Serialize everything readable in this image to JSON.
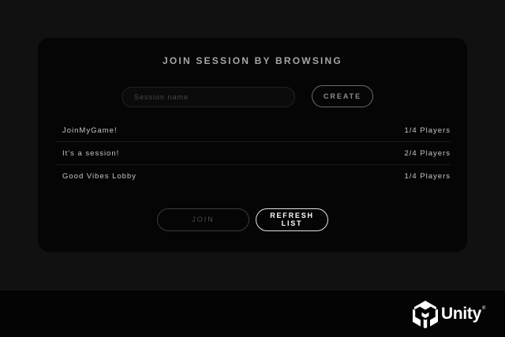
{
  "panel": {
    "title": "JOIN SESSION BY BROWSING",
    "search": {
      "value": "",
      "placeholder": "Session name"
    },
    "create_label": "CREATE"
  },
  "sessions": [
    {
      "name": "JoinMyGame!",
      "players": "1/4 Players"
    },
    {
      "name": "It's a session!",
      "players": "2/4 Players"
    },
    {
      "name": "Good Vibes Lobby",
      "players": "1/4 Players"
    }
  ],
  "actions": {
    "join_label": "JOIN",
    "refresh_line1": "REFRESH",
    "refresh_line2": "LIST"
  },
  "branding": {
    "logo_text": "Unity",
    "logo_mark": "®",
    "logo_icon": "unity-cube-icon"
  },
  "colors": {
    "background": "#111111",
    "panel": "#050505",
    "text": "#c6c6c6",
    "title": "#a6a6a6",
    "accent_border": "#e0e0e0"
  }
}
